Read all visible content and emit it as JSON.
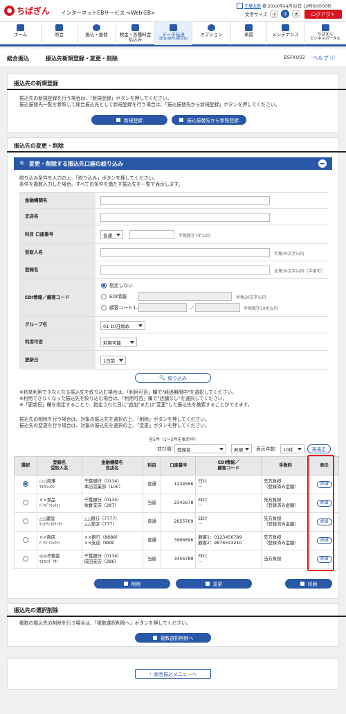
{
  "header": {
    "logo": "ちばぎん",
    "service": "インターネットEBサービス <Web-EB>",
    "user_name": "千葉太郎",
    "user_suffix": "様",
    "last_login": "20XX年04月02日 10時00分00秒",
    "font_size_label": "文字サイズ",
    "fs_small": "小",
    "fs_mid": "中",
    "fs_large": "大",
    "logout": "ログアウト"
  },
  "nav": [
    {
      "label": "ホーム",
      "l2": ""
    },
    {
      "label": "照会",
      "l2": ""
    },
    {
      "label": "振込・振替",
      "l2": ""
    },
    {
      "label": "税金・各種料金",
      "l2": "払込み"
    },
    {
      "label": "データ伝送",
      "l2": "(総合(給与)振込先)"
    },
    {
      "label": "オプション",
      "l2": ""
    },
    {
      "label": "承認",
      "l2": ""
    },
    {
      "label": "メンテナンス",
      "l2": ""
    },
    {
      "label": "ちばぎん",
      "l2": "ビジネスポータル"
    }
  ],
  "page": {
    "crumb1": "総合振込",
    "crumb2": "振込先新規登録・変更・削除",
    "code": "BSFK002",
    "help": "ヘルプ"
  },
  "new_section": {
    "title": "振込先の新規登録",
    "line1": "振込先の新規登録を行う場合は、「新規登録」ボタンを押してください。",
    "line2": "振込振替先一覧を参照して総合振込先として新規登録を行う場合は、「振込振替先から新規登録」ボタンを押してください。",
    "btn_new": "新規登録",
    "btn_from": "振込振替先から参照登録"
  },
  "change_section": {
    "title": "振込先の変更・削除",
    "filter_title": "変更・削除する振込先口座の絞り込み",
    "line1": "絞り込み条件を入力の上、「絞り込み」ボタンを押してください。",
    "line2": "条件を複数入力した場合、すべての条件を満たす振込先を一覧で表示します。"
  },
  "filter": {
    "bank": "金融機関名",
    "branch": "支店名",
    "acct": "科目 口座番号",
    "acct_type": "普通",
    "acct_note": "半角数字7桁以内",
    "payee": "受取人名",
    "payee_note": "半角30文字以内",
    "reg": "登録名",
    "reg_note": "全角30文字以内［半角可］",
    "edi": "EDI情報／顧客コード",
    "edi_l2": "",
    "edi_opt1": "指定しない",
    "edi_opt2": "EDI情報",
    "edi_note2": "半角20文字以内",
    "edi_opt3": "顧客コード1／2",
    "edi_note3": "半角数字10桁以内",
    "group": "グループ名",
    "group_val": "01 10日締め",
    "usage": "利用可否",
    "usage_val": "利用可能",
    "update": "更新日",
    "update_val": "1日前",
    "btn": "絞り込み"
  },
  "notes": {
    "n1": "※将来利用できなくなる振込先を絞り込む場合は、「利用可否」欄で\"経過期間中\"を選択してください。",
    "n2": "※利用できなくなった振込先を絞り込む場合は、「利用可否」欄で\"店舗なし\"を選択してください。",
    "n3": "※「更新日」欄を指定することで、指定された日に\"追加\"または\"変更\"した振込先を検索することができます。",
    "d1": "振込先の削除を行う場合は、対象の振込先を選択の上、「削除」ボタンを押してください。",
    "d2": "振込先の変更を行う場合は、対象の振込先を選択の上、「変更」ボタンを押してください。"
  },
  "list": {
    "count": "全5件（1～5件を表示中）",
    "sort_label": "並び順：",
    "sort_val": "登録名",
    "order": "昇順",
    "per_label": "表示件数：",
    "per_val": "10件",
    "redisplay": "再表示",
    "h_sel": "選択",
    "h_name": "登録名",
    "h_name2": "受取人名",
    "h_bank": "金融機関名",
    "h_bank2": "支店名",
    "h_type": "科目",
    "h_acct": "口座番号",
    "h_edi": "EDI情報／",
    "h_edi2": "顧客コード",
    "h_fee": "手数料",
    "h_show": "表示",
    "detail": "詳細",
    "rows": [
      {
        "name": "○○商事",
        "kana": "ﾏﾙﾏﾙｼｮｳｼﾞ",
        "bank": "千葉銀行（0134）",
        "branch": "本店営業部（100）",
        "type": "普通",
        "acct": "1234566",
        "edi1": "EDI：",
        "edi2": "－",
        "fee": "先方負担",
        "fee2": "（登録済み金額）"
      },
      {
        "name": "××食品",
        "kana": "ﾊﾞﾂﾊﾞﾂｼｮｸﾋﾝ",
        "bank": "千葉銀行（0134）",
        "branch": "佐倉支店（287）",
        "type": "当座",
        "acct": "2345678",
        "edi1": "EDI：",
        "edi2": "－",
        "fee": "先方負担",
        "fee2": "（登録済み金額）"
      },
      {
        "name": "△△建設",
        "kana": "ｻﾝｶｸｻﾝｶｸｹﾝｾﾂ",
        "bank": "△△銀行（7777）",
        "branch": "△△支店（777）",
        "type": "普通",
        "acct": "2655769",
        "edi1": "EDI：",
        "edi2": "－",
        "fee": "先方負担",
        "fee2": "（登録済み金額）"
      },
      {
        "name": "××商店",
        "kana": "ﾊﾞﾂﾊﾞﾂｼｮｳﾃﾝ",
        "bank": "××銀行（8888）",
        "branch": "××支店（888）",
        "type": "普通",
        "acct": "3966896",
        "edi1": "顧客1：0123456789",
        "edi2": "顧客2：9876543210",
        "fee": "先方負担",
        "fee2": "（登録済み金額）"
      },
      {
        "name": "◎◎不動産",
        "kana": "ﾏﾙﾏﾙﾌﾄﾞｳｻﾝ",
        "bank": "千葉銀行（0134）",
        "branch": "成田支店（286）",
        "type": "当座",
        "acct": "3456789",
        "edi1": "EDI：",
        "edi2": "－",
        "fee": "当方負担",
        "fee2": ""
      }
    ],
    "btn_delete": "削除",
    "btn_change": "変更",
    "btn_print": "印刷"
  },
  "bulk": {
    "title": "振込先の選択削除",
    "line": "複数の振込先の削除を行う場合は、「複数選択削除へ」ボタンを押してください。",
    "btn": "複数選択削除へ"
  },
  "back": "総合振込メニューへ"
}
